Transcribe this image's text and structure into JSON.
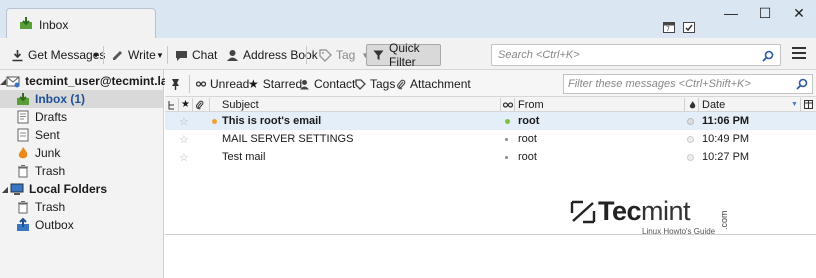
{
  "window": {
    "tab_label": "Inbox",
    "controls": [
      "minimize",
      "maximize",
      "close"
    ]
  },
  "toolbar": {
    "get_messages": "Get Messages",
    "write": "Write",
    "chat": "Chat",
    "address_book": "Address Book",
    "tag": "Tag",
    "quick_filter": "Quick Filter",
    "search_placeholder": "Search <Ctrl+K>"
  },
  "folders": {
    "account": "tecmint_user@tecmint.lan",
    "inbox": "Inbox (1)",
    "drafts": "Drafts",
    "sent": "Sent",
    "junk": "Junk",
    "trash": "Trash",
    "local_folders": "Local Folders",
    "local_trash": "Trash",
    "outbox": "Outbox"
  },
  "filterbar": {
    "unread": "Unread",
    "starred": "Starred",
    "contact": "Contact",
    "tags": "Tags",
    "attachment": "Attachment",
    "placeholder": "Filter these messages <Ctrl+Shift+K>"
  },
  "columns": {
    "subject": "Subject",
    "from": "From",
    "date": "Date"
  },
  "messages": [
    {
      "subject": "This is root's email",
      "from": "root",
      "date": "11:06 PM",
      "unread": true
    },
    {
      "subject": "MAIL SERVER SETTINGS",
      "from": "root",
      "date": "10:49 PM",
      "unread": false
    },
    {
      "subject": "Test mail",
      "from": "root",
      "date": "10:27 PM",
      "unread": false
    }
  ],
  "watermark": {
    "brand_a": "Tec",
    "brand_b": "mint",
    "com": ".com",
    "tagline": "Linux Howto's Guide"
  },
  "colors": {
    "selected_row": "#e4eef9",
    "folder_selected": "#d9d9d9",
    "unread_dot": "#f0a030",
    "online_dot": "#7cc142"
  }
}
